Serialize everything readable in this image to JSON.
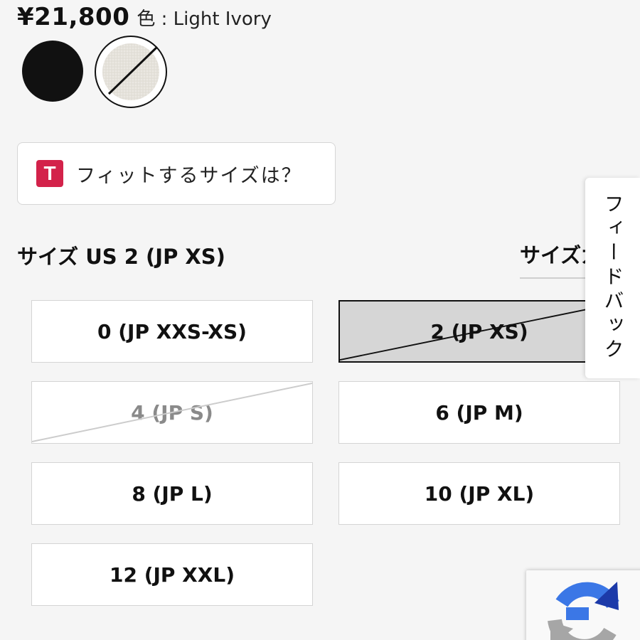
{
  "product": {
    "price": "¥21,800",
    "color_label": "色 : Light Ivory",
    "swatches": [
      {
        "name": "black",
        "color": "#111111",
        "available": true
      },
      {
        "name": "light-ivory",
        "color": "#ebe8e2",
        "available": false,
        "selected": true
      }
    ]
  },
  "fit_finder": {
    "icon_letter": "T",
    "icon_color": "#d3224a",
    "label": "フィットするサイズは？"
  },
  "size": {
    "selected_label": "サイズ US 2 (JP XS)",
    "guide_label": "サイズガイド",
    "options": [
      {
        "label": "0 (JP XXS-XS)",
        "state": "available"
      },
      {
        "label": "2 (JP XS)",
        "state": "selected-unavailable"
      },
      {
        "label": "4 (JP S)",
        "state": "unavailable"
      },
      {
        "label": "6 (JP M)",
        "state": "available"
      },
      {
        "label": "8 (JP L)",
        "state": "available"
      },
      {
        "label": "10 (JP XL)",
        "state": "available"
      },
      {
        "label": "12 (JP XXL)",
        "state": "available"
      }
    ]
  },
  "feedback": {
    "label": "フィードバック"
  },
  "recaptcha": {
    "icon": "recaptcha-icon",
    "colors": {
      "blue": "#3b77e6",
      "gray": "#a6a6a6",
      "dark_blue": "#1c3aa9"
    }
  }
}
